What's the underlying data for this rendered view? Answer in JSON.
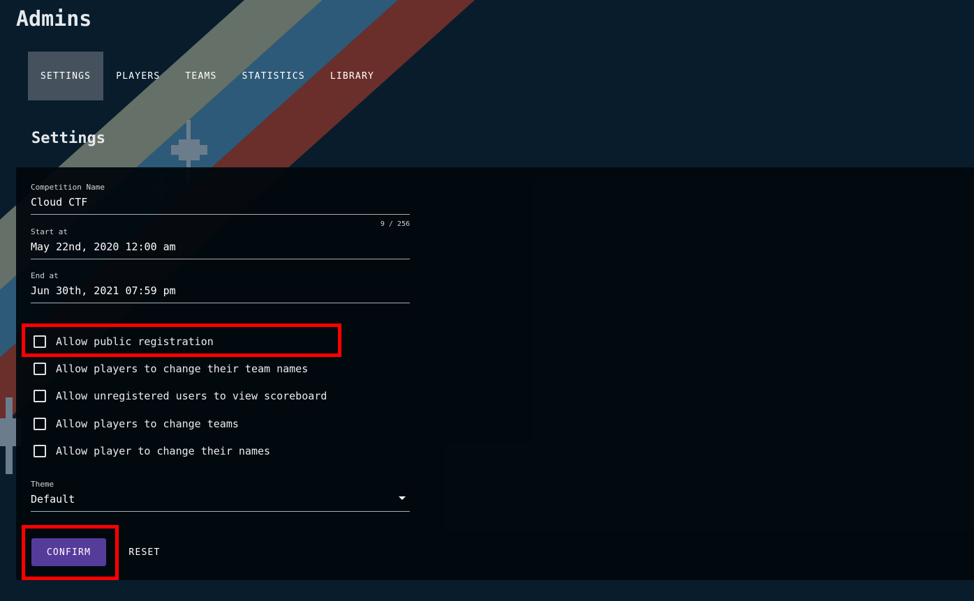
{
  "header": {
    "title": "Admins"
  },
  "tabs": [
    {
      "label": "SETTINGS",
      "active": true
    },
    {
      "label": "PLAYERS"
    },
    {
      "label": "TEAMS"
    },
    {
      "label": "STATISTICS"
    },
    {
      "label": "LIBRARY"
    }
  ],
  "section_title": "Settings",
  "form": {
    "competition_name": {
      "label": "Competition Name",
      "value": "Cloud CTF",
      "counter": "9 / 256"
    },
    "start_at": {
      "label": "Start at",
      "value": "May 22nd, 2020 12:00 am"
    },
    "end_at": {
      "label": "End at",
      "value": "Jun 30th, 2021 07:59 pm"
    },
    "checkboxes": [
      {
        "label": "Allow public registration",
        "checked": false
      },
      {
        "label": "Allow players to change their team names",
        "checked": false
      },
      {
        "label": "Allow unregistered users to view scoreboard",
        "checked": false
      },
      {
        "label": "Allow players to change teams",
        "checked": false
      },
      {
        "label": "Allow player to change their names",
        "checked": false
      }
    ],
    "theme": {
      "label": "Theme",
      "value": "Default"
    },
    "confirm_label": "CONFIRM",
    "reset_label": "RESET"
  },
  "colors": {
    "background": "#081c2c",
    "confirm": "#553c9a",
    "highlight": "#ff0000",
    "stripe_grey": "#657068",
    "stripe_blue": "#2d5a78",
    "stripe_red": "#6a2f2a"
  }
}
